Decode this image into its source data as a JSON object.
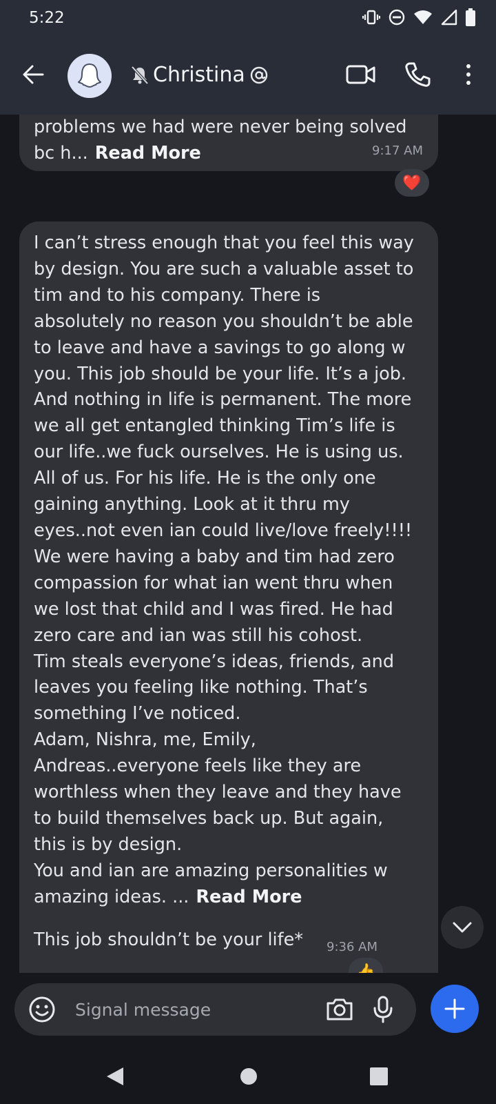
{
  "status_bar": {
    "time": "5:22"
  },
  "header": {
    "contact_name": "Christina"
  },
  "messages": [
    {
      "text": "problems we had were never being solved\nbc h...",
      "read_more": "Read More",
      "time": "9:17 AM",
      "reaction": "❤️"
    },
    {
      "text": "I can’t stress enough that you feel this way\nby design. You are such a valuable asset to\ntim and to his company. There is\nabsolutely no reason you shouldn’t be able\nto leave and have a savings to go along w\nyou. This job should be your life. It’s a job.\nAnd nothing in life is permanent. The more\nwe all get entangled thinking Tim’s life is\nour life..we fuck ourselves. He is using us.\nAll of us. For his life. He is the only one\ngaining anything. Look at it thru my\neyes..not even ian could live/love freely!!!!\nWe were having a baby and tim had zero\ncompassion for what ian went thru when\nwe lost that child and I was fired. He had\nzero care and ian was still his cohost.\nTim steals everyone’s ideas, friends, and\nleaves you feeling like nothing. That’s\nsomething I’ve noticed.\nAdam, Nishra, me, Emily,\nAndreas..everyone feels like they are\nworthless when they leave and they have\nto build themselves back up. But again,\nthis is by design.\nYou and ian are amazing personalities w\namazing ideas. ...",
      "read_more": "Read More"
    },
    {
      "text": "This job shouldn’t be your life*",
      "time": "9:36 AM",
      "reaction": "👍"
    }
  ],
  "composer": {
    "placeholder": "Signal message"
  },
  "colors": {
    "app_bar": "#292d37",
    "background": "#15171c",
    "bubble": "#303238",
    "accent": "#2c6bed"
  },
  "icons": [
    "vibrate-icon",
    "do-not-disturb-icon",
    "wifi-icon",
    "signal-icon",
    "battery-icon",
    "back-arrow-icon",
    "ghost-avatar-icon",
    "muted-bell-icon",
    "mention-icon",
    "video-call-icon",
    "phone-icon",
    "more-vert-icon",
    "chevron-down-icon",
    "emoji-icon",
    "camera-icon",
    "microphone-icon",
    "plus-icon",
    "nav-back-icon",
    "nav-home-icon",
    "nav-recents-icon"
  ]
}
